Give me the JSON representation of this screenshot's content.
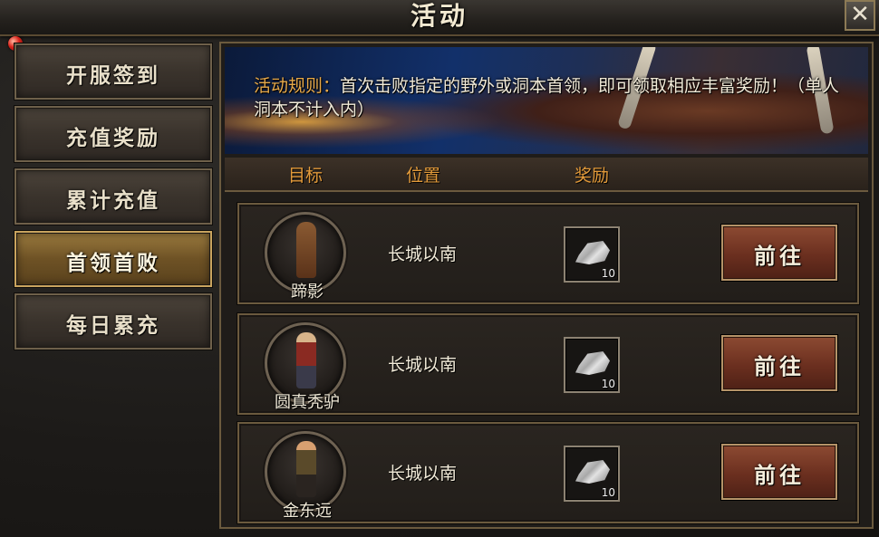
{
  "window": {
    "title": "活动",
    "close_label": "✕"
  },
  "sidebar": {
    "tabs": [
      {
        "label": "开服签到",
        "active": false
      },
      {
        "label": "充值奖励",
        "active": false
      },
      {
        "label": "累计充值",
        "active": false
      },
      {
        "label": "首领首败",
        "active": true
      },
      {
        "label": "每日累充",
        "active": false
      }
    ]
  },
  "rules": {
    "label": "活动规则：",
    "text": "首次击败指定的野外或洞本首领，即可领取相应丰富奖励！（单人洞本不计入内）"
  },
  "table": {
    "headers": {
      "target": "目标",
      "location": "位置",
      "reward": "奖励"
    },
    "rows": [
      {
        "boss": "蹄影",
        "location": "长城以南",
        "reward_qty": "10",
        "button": "前往"
      },
      {
        "boss": "圆真秃驴",
        "location": "长城以南",
        "reward_qty": "10",
        "button": "前往"
      },
      {
        "boss": "金东远",
        "location": "长城以南",
        "reward_qty": "10",
        "button": "前往"
      }
    ]
  }
}
